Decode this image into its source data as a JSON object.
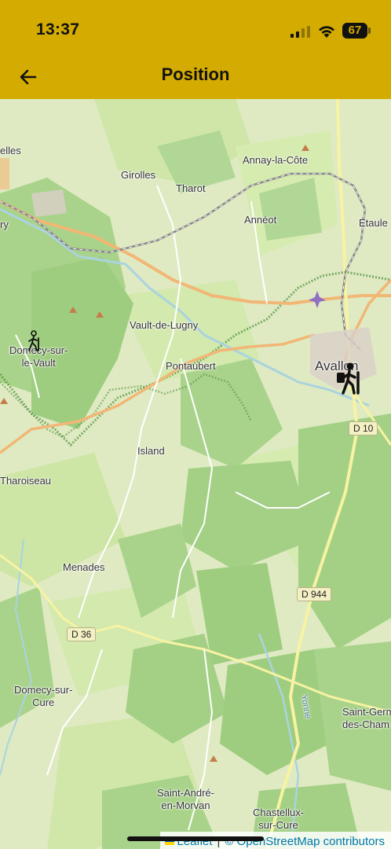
{
  "status_bar": {
    "time": "13:37",
    "battery_level": "67"
  },
  "app_bar": {
    "title": "Position",
    "back_icon": "arrow-left-icon"
  },
  "map": {
    "places": [
      {
        "id": "lles",
        "text": "elles"
      },
      {
        "id": "girolles",
        "text": "Girolles"
      },
      {
        "id": "annay",
        "text": "Annay-la-Côte"
      },
      {
        "id": "tharot",
        "text": "Tharot"
      },
      {
        "id": "ry",
        "text": "ry"
      },
      {
        "id": "anneot",
        "text": "Annéot"
      },
      {
        "id": "etaule",
        "text": "Étaule"
      },
      {
        "id": "vault",
        "text": "Vault-de-Lugny"
      },
      {
        "id": "domecy_vault",
        "text": "Domecy-sur-\nle-Vault"
      },
      {
        "id": "pontaubert",
        "text": "Pontaubert"
      },
      {
        "id": "avallon",
        "text": "Avallon"
      },
      {
        "id": "island",
        "text": "Island"
      },
      {
        "id": "tharoiseau",
        "text": "Tharoiseau"
      },
      {
        "id": "menades",
        "text": "Menades"
      },
      {
        "id": "domecy_cure",
        "text": "Domecy-sur-\nCure"
      },
      {
        "id": "saint_germain",
        "text": "Saint-Germ\ndes-Cham"
      },
      {
        "id": "saint_andre",
        "text": "Saint-André-\nen-Morvan"
      },
      {
        "id": "chastellux",
        "text": "Chastellux-\nsur-Cure"
      },
      {
        "id": "yonne",
        "text": "Yonne"
      }
    ],
    "road_shields": [
      {
        "id": "d10",
        "text": "D 10"
      },
      {
        "id": "d944",
        "text": "D 944"
      },
      {
        "id": "d36",
        "text": "D 36"
      }
    ],
    "markers": [
      {
        "id": "hiker_small",
        "icon": "hiker-icon"
      },
      {
        "id": "hiker_large",
        "icon": "hiker-position-icon"
      }
    ],
    "colors": {
      "forest": "#a9d38a",
      "meadow": "#cfe6a8",
      "water": "#aad3df",
      "main_road": "#f2b675",
      "secondary_road": "#f7f3a3",
      "park_boundary": "#4f8f3c",
      "rail": "#777777"
    }
  },
  "attribution": {
    "leaflet": "Leaflet",
    "separator": "|",
    "osm": "© OpenStreetMap contributors"
  },
  "theme": {
    "header_color": "#d4ab00"
  }
}
